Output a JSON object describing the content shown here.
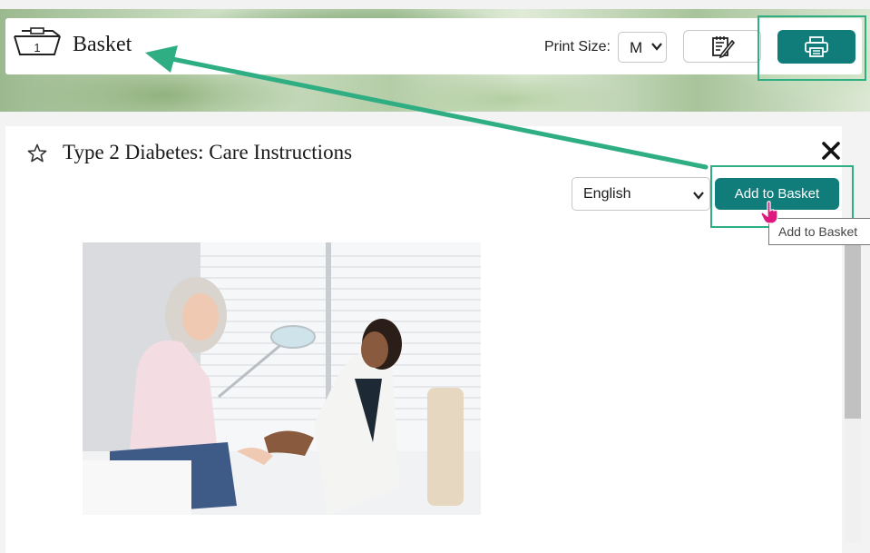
{
  "header": {
    "basket_title": "Basket",
    "basket_count": "1",
    "print_size_label": "Print Size:",
    "print_size_value": "M"
  },
  "item": {
    "title": "Type 2 Diabetes: Care Instructions",
    "language_value": "English",
    "add_button_label": "Add to Basket",
    "tooltip": "Add to Basket"
  },
  "colors": {
    "accent": "#117d7a",
    "highlight": "#2fae83",
    "cursor": "#e0177e"
  },
  "icons": {
    "basket": "basket-icon",
    "notes": "notes-pencil-icon",
    "print": "printer-icon",
    "favorite": "star-outline-icon",
    "close": "close-x-icon"
  }
}
